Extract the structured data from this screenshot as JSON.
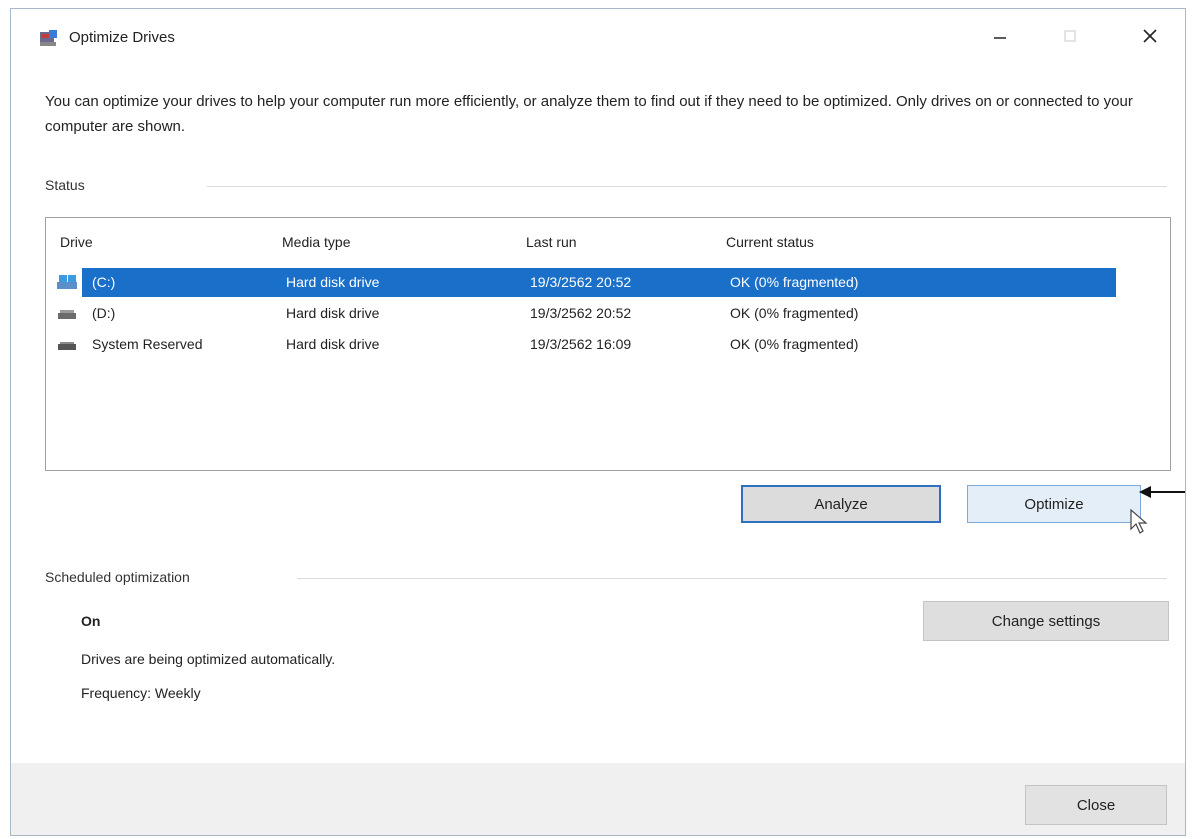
{
  "window": {
    "title": "Optimize Drives",
    "intro": "You can optimize your drives to help your computer run more efficiently, or analyze them to find out if they need to be optimized. Only drives on or connected to your computer are shown."
  },
  "status": {
    "heading": "Status",
    "columns": {
      "drive": "Drive",
      "media_type": "Media type",
      "last_run": "Last run",
      "current_status": "Current status"
    },
    "drives": [
      {
        "name": "(C:)",
        "media_type": "Hard disk drive",
        "last_run": "19/3/2562 20:52",
        "status": "OK (0% fragmented)",
        "icon": "windows-drive-icon",
        "selected": true
      },
      {
        "name": "(D:)",
        "media_type": "Hard disk drive",
        "last_run": "19/3/2562 20:52",
        "status": "OK (0% fragmented)",
        "icon": "hard-drive-icon",
        "selected": false
      },
      {
        "name": "System Reserved",
        "media_type": "Hard disk drive",
        "last_run": "19/3/2562 16:09",
        "status": "OK (0% fragmented)",
        "icon": "hard-drive-icon",
        "selected": false
      }
    ],
    "analyze_label": "Analyze",
    "optimize_label": "Optimize"
  },
  "scheduled": {
    "heading": "Scheduled optimization",
    "state": "On",
    "description": "Drives are being optimized automatically.",
    "frequency": "Frequency: Weekly",
    "change_label": "Change settings"
  },
  "footer": {
    "close_label": "Close"
  },
  "colors": {
    "selection": "#1a6fc9",
    "focus_border": "#2c6fbf"
  }
}
